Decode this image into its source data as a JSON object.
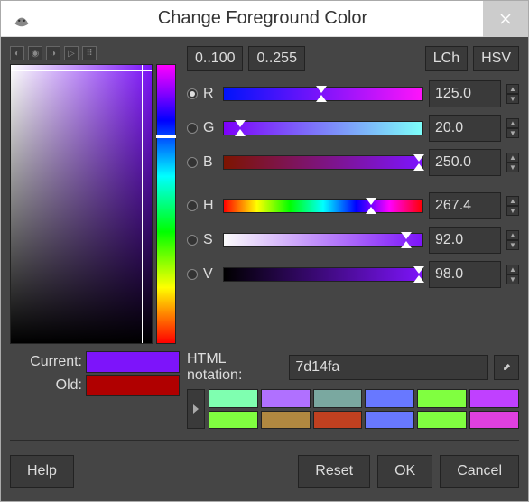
{
  "window": {
    "title": "Change Foreground Color"
  },
  "ranges": {
    "r100": "0..100",
    "r255": "0..255",
    "lch": "LCh",
    "hsv": "HSV"
  },
  "channels": {
    "R": {
      "label": "R",
      "value": "125.0",
      "pos": 49
    },
    "G": {
      "label": "G",
      "value": "20.0",
      "pos": 8
    },
    "B": {
      "label": "B",
      "value": "250.0",
      "pos": 98
    },
    "H": {
      "label": "H",
      "value": "267.4",
      "pos": 74
    },
    "S": {
      "label": "S",
      "value": "92.0",
      "pos": 92
    },
    "V": {
      "label": "V",
      "value": "98.0",
      "pos": 98
    }
  },
  "selected_channel": "R",
  "html_notation": {
    "label": "HTML notation:",
    "value": "7d14fa"
  },
  "current": {
    "label": "Current:",
    "color": "#7d14fa"
  },
  "old": {
    "label": "Old:",
    "color": "#b00000"
  },
  "swatches": [
    "#7fffb0",
    "#b070ff",
    "#7aa8a0",
    "#6878ff",
    "#80ff40",
    "#c040ff",
    "#80ff40",
    "#b08840",
    "#c04020",
    "#6878ff",
    "#80ff40",
    "#e040e0"
  ],
  "buttons": {
    "help": "Help",
    "reset": "Reset",
    "ok": "OK",
    "cancel": "Cancel"
  },
  "gradients": {
    "R": "linear-gradient(to right,#0014fa,#ff14fa)",
    "G": "linear-gradient(to right,#7d00fa,#7dfffa)",
    "B": "linear-gradient(to right,#7d1400,#7d14ff)",
    "H": "linear-gradient(to right,#f00,#ff0,#0f0,#0ff,#00f,#f0f,#f00)",
    "S": "linear-gradient(to right,#fafafa,#7d14fa)",
    "V": "linear-gradient(to right,#000,#7d14fa)"
  }
}
